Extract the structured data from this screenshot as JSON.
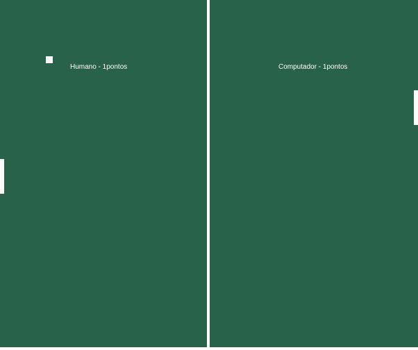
{
  "scoreboard": {
    "left_score": "Humano - 1pontos",
    "right_score": "Computador - 1pontos"
  },
  "players": [
    {
      "name": "Humano",
      "points": 1
    },
    {
      "name": "Computador",
      "points": 1
    }
  ],
  "colors": {
    "field": "#286249",
    "foreground": "#ffffff"
  }
}
